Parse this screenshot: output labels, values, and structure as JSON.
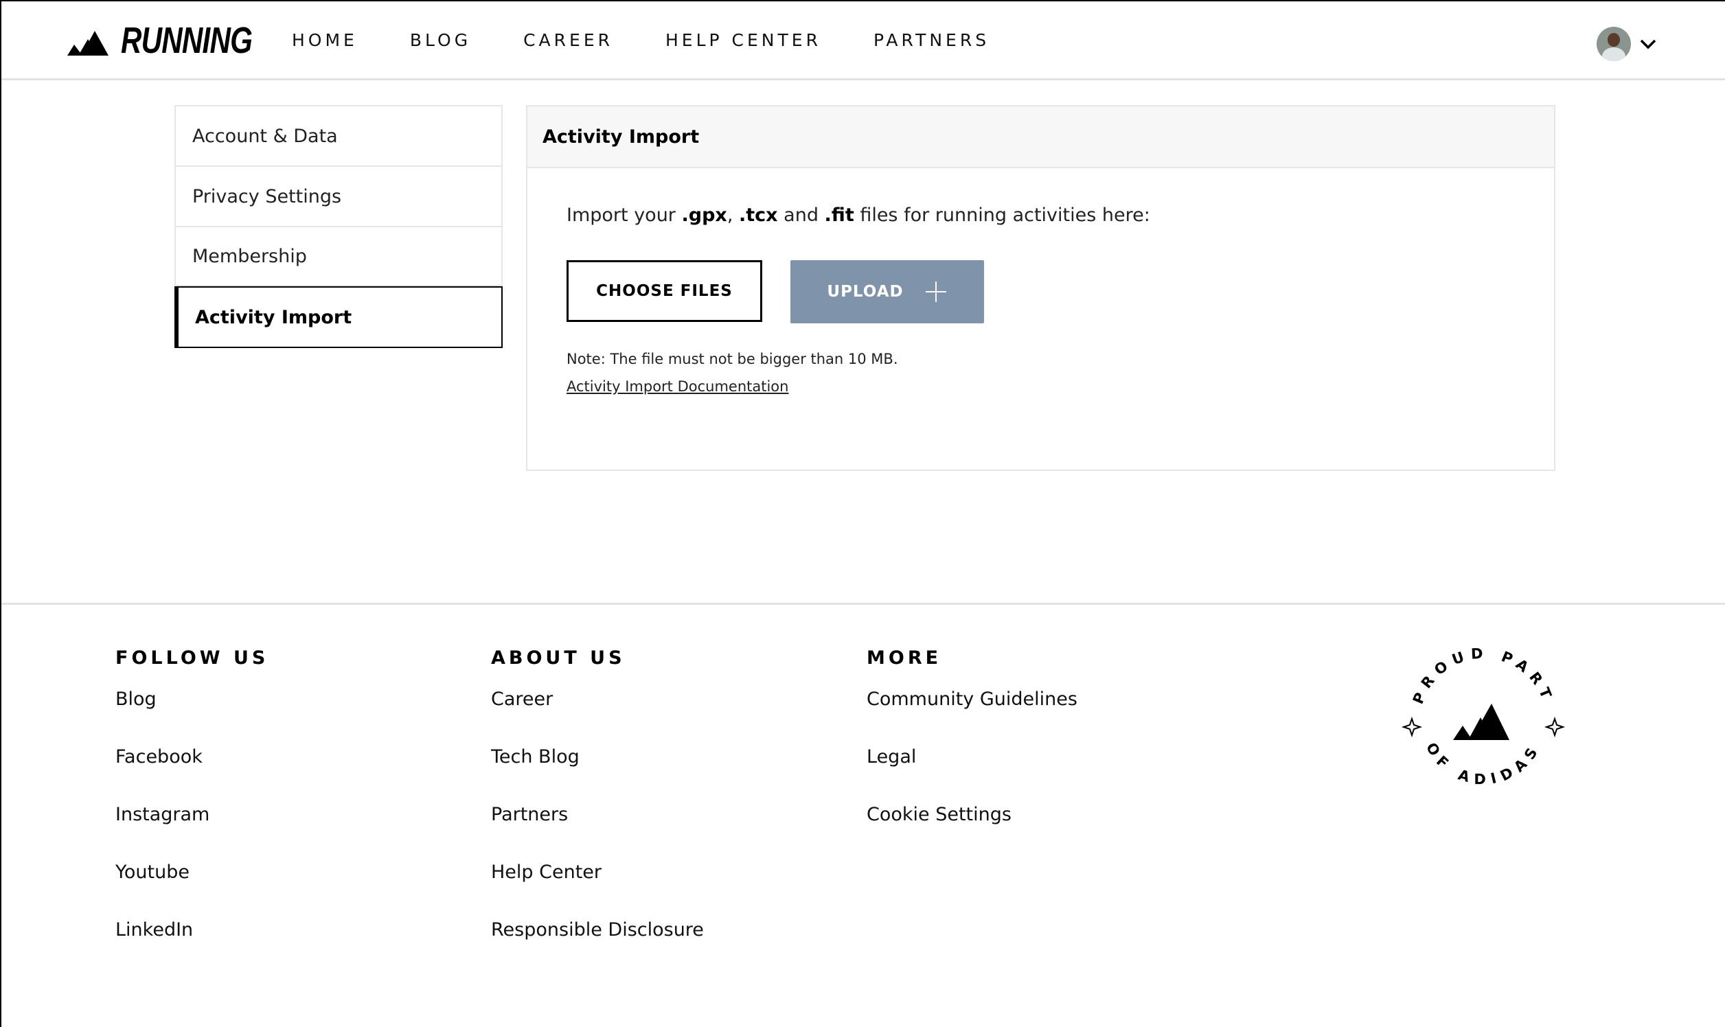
{
  "header": {
    "logo_text": "RUNNING",
    "nav": [
      "HOME",
      "BLOG",
      "CAREER",
      "HELP CENTER",
      "PARTNERS"
    ]
  },
  "sidebar": {
    "items": [
      {
        "label": "Account & Data",
        "active": false
      },
      {
        "label": "Privacy Settings",
        "active": false
      },
      {
        "label": "Membership",
        "active": false
      },
      {
        "label": "Activity Import",
        "active": true
      }
    ]
  },
  "panel": {
    "title": "Activity Import",
    "intro_pre": "Import your ",
    "ext1": ".gpx",
    "sep1": ", ",
    "ext2": ".tcx",
    "sep2": " and ",
    "ext3": ".fit",
    "intro_post": " files for running activities here:",
    "choose_label": "CHOOSE FILES",
    "upload_label": "UPLOAD",
    "note": "Note: The file must not be bigger than 10 MB.",
    "doc_link": "Activity Import Documentation"
  },
  "footer": {
    "follow": {
      "title": "FOLLOW US",
      "links": [
        "Blog",
        "Facebook",
        "Instagram",
        "Youtube",
        "LinkedIn"
      ]
    },
    "about": {
      "title": "ABOUT US",
      "links": [
        "Career",
        "Tech Blog",
        "Partners",
        "Help Center",
        "Responsible Disclosure"
      ]
    },
    "more": {
      "title": "MORE",
      "links": [
        "Community Guidelines",
        "Legal",
        "Cookie Settings"
      ]
    },
    "badge_top": "PROUD PART",
    "badge_bottom": "OF ADIDAS"
  },
  "colors": {
    "upload_button": "#7f94aa",
    "accent": "#000000"
  },
  "icons": [
    "adidas-logo-icon",
    "avatar",
    "chevron-down-icon",
    "plus-icon",
    "adidas-badge-icon"
  ]
}
